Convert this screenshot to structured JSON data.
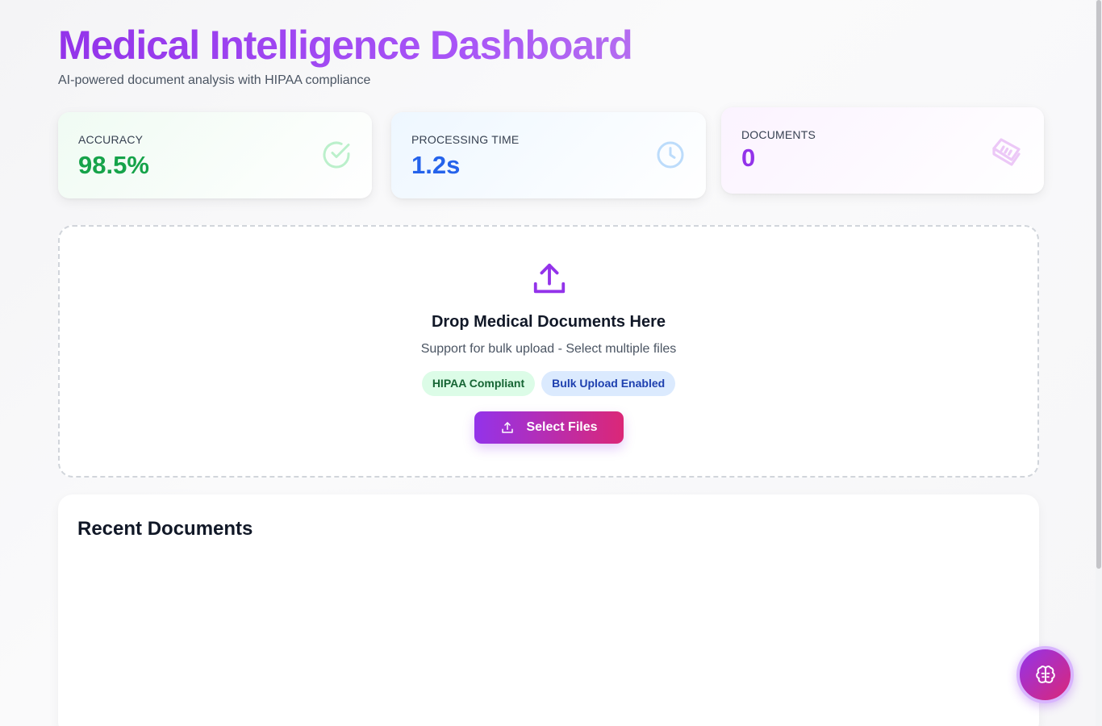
{
  "header": {
    "title": "Medical Intelligence Dashboard",
    "subtitle": "AI-powered document analysis with HIPAA compliance"
  },
  "stats": [
    {
      "label": "Accuracy",
      "value": "98.5%",
      "icon": "check-circle-icon",
      "color": "#16a34a"
    },
    {
      "label": "Processing Time",
      "value": "1.2s",
      "icon": "clock-icon",
      "color": "#2563eb"
    },
    {
      "label": "Documents",
      "value": "0",
      "icon": "documents-icon",
      "color": "#9333ea"
    }
  ],
  "upload": {
    "icon": "upload-icon",
    "title": "Drop Medical Documents Here",
    "subtitle": "Support for bulk upload - Select multiple files",
    "badges": [
      "HIPAA Compliant",
      "Bulk Upload Enabled"
    ],
    "button_label": "Select Files"
  },
  "recent": {
    "title": "Recent Documents",
    "items": []
  },
  "fab": {
    "icon": "brain-icon"
  },
  "colors": {
    "accent": "#9333ea",
    "accent_secondary": "#db2777"
  }
}
